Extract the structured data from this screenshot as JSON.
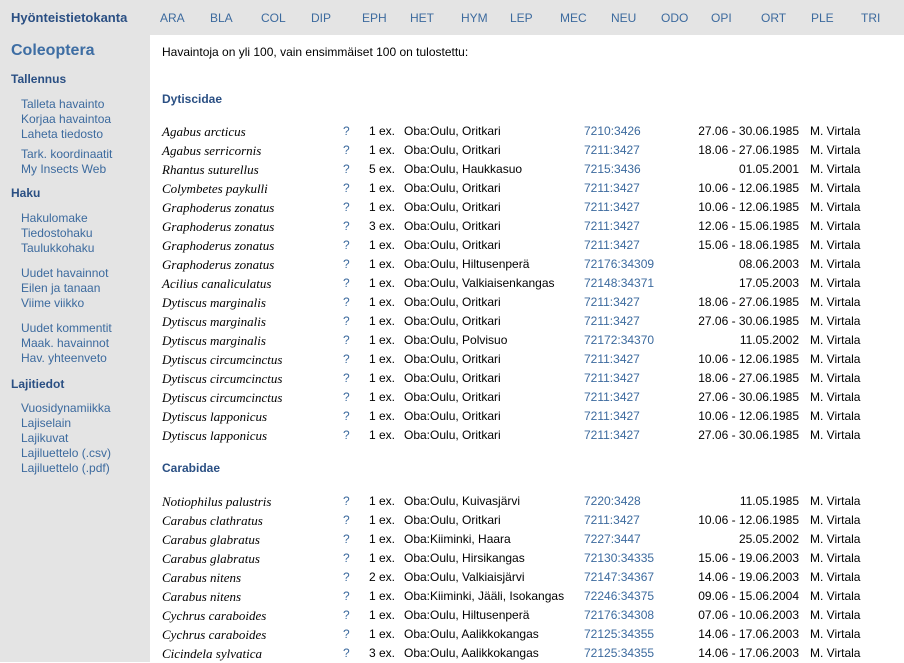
{
  "header": {
    "title": "Hyönteistietokanta",
    "nav": [
      "ARA",
      "BLA",
      "COL",
      "DIP",
      "EPH",
      "HET",
      "HYM",
      "LEP",
      "MEC",
      "NEU",
      "ODO",
      "OPI",
      "ORT",
      "PLE",
      "TRI"
    ]
  },
  "sidebar": {
    "title": "Coleoptera",
    "sections": [
      {
        "heading": "Tallennus",
        "links": [
          "Talleta havainto",
          "Korjaa havaintoa",
          "Laheta tiedosto",
          "Tark. koordinaatit",
          "My Insects Web"
        ]
      },
      {
        "heading": "Haku",
        "links": [
          "Hakulomake",
          "Tiedostohaku",
          "Taulukkohaku",
          "Uudet havainnot",
          "Eilen ja tanaan",
          "Viime viikko",
          "Uudet kommentit",
          "Maak. havainnot",
          "Hav. yhteenveto"
        ]
      },
      {
        "heading": "Lajitiedot",
        "links": [
          "Vuosidynamiikka",
          "Lajiselain",
          "Lajikuvat",
          "Lajiluettelo (.csv)",
          "Lajiluettelo (.pdf)"
        ]
      }
    ]
  },
  "main": {
    "intro": "Havaintoja on yli 100, vain ensimmäiset 100 on tulostettu:",
    "families": [
      {
        "name": "Dytiscidae",
        "rows": [
          {
            "species": "Agabus arcticus",
            "q": "?",
            "count": "1 ex.",
            "location": "Oba:Oulu, Oritkari",
            "grid": "7210:3426",
            "date": "27.06 - 30.06.1985",
            "observer": "M. Virtala"
          },
          {
            "species": "Agabus serricornis",
            "q": "?",
            "count": "1 ex.",
            "location": "Oba:Oulu, Oritkari",
            "grid": "7211:3427",
            "date": "18.06 - 27.06.1985",
            "observer": "M. Virtala"
          },
          {
            "species": "Rhantus suturellus",
            "q": "?",
            "count": "5 ex.",
            "location": "Oba:Oulu, Haukkasuo",
            "grid": "7215:3436",
            "date": "01.05.2001",
            "observer": "M. Virtala"
          },
          {
            "species": "Colymbetes paykulli",
            "q": "?",
            "count": "1 ex.",
            "location": "Oba:Oulu, Oritkari",
            "grid": "7211:3427",
            "date": "10.06 - 12.06.1985",
            "observer": "M. Virtala"
          },
          {
            "species": "Graphoderus zonatus",
            "q": "?",
            "count": "1 ex.",
            "location": "Oba:Oulu, Oritkari",
            "grid": "7211:3427",
            "date": "10.06 - 12.06.1985",
            "observer": "M. Virtala"
          },
          {
            "species": "Graphoderus zonatus",
            "q": "?",
            "count": "3 ex.",
            "location": "Oba:Oulu, Oritkari",
            "grid": "7211:3427",
            "date": "12.06 - 15.06.1985",
            "observer": "M. Virtala"
          },
          {
            "species": "Graphoderus zonatus",
            "q": "?",
            "count": "1 ex.",
            "location": "Oba:Oulu, Oritkari",
            "grid": "7211:3427",
            "date": "15.06 - 18.06.1985",
            "observer": "M. Virtala"
          },
          {
            "species": "Graphoderus zonatus",
            "q": "?",
            "count": "1 ex.",
            "location": "Oba:Oulu, Hiltusenperä",
            "grid": "72176:34309",
            "date": "08.06.2003",
            "observer": "M. Virtala"
          },
          {
            "species": "Acilius canaliculatus",
            "q": "?",
            "count": "1 ex.",
            "location": "Oba:Oulu, Valkiaisenkangas",
            "grid": "72148:34371",
            "date": "17.05.2003",
            "observer": "M. Virtala"
          },
          {
            "species": "Dytiscus marginalis",
            "q": "?",
            "count": "1 ex.",
            "location": "Oba:Oulu, Oritkari",
            "grid": "7211:3427",
            "date": "18.06 - 27.06.1985",
            "observer": "M. Virtala"
          },
          {
            "species": "Dytiscus marginalis",
            "q": "?",
            "count": "1 ex.",
            "location": "Oba:Oulu, Oritkari",
            "grid": "7211:3427",
            "date": "27.06 - 30.06.1985",
            "observer": "M. Virtala"
          },
          {
            "species": "Dytiscus marginalis",
            "q": "?",
            "count": "1 ex.",
            "location": "Oba:Oulu, Polvisuo",
            "grid": "72172:34370",
            "date": "11.05.2002",
            "observer": "M. Virtala"
          },
          {
            "species": "Dytiscus circumcinctus",
            "q": "?",
            "count": "1 ex.",
            "location": "Oba:Oulu, Oritkari",
            "grid": "7211:3427",
            "date": "10.06 - 12.06.1985",
            "observer": "M. Virtala"
          },
          {
            "species": "Dytiscus circumcinctus",
            "q": "?",
            "count": "1 ex.",
            "location": "Oba:Oulu, Oritkari",
            "grid": "7211:3427",
            "date": "18.06 - 27.06.1985",
            "observer": "M. Virtala"
          },
          {
            "species": "Dytiscus circumcinctus",
            "q": "?",
            "count": "1 ex.",
            "location": "Oba:Oulu, Oritkari",
            "grid": "7211:3427",
            "date": "27.06 - 30.06.1985",
            "observer": "M. Virtala"
          },
          {
            "species": "Dytiscus lapponicus",
            "q": "?",
            "count": "1 ex.",
            "location": "Oba:Oulu, Oritkari",
            "grid": "7211:3427",
            "date": "10.06 - 12.06.1985",
            "observer": "M. Virtala"
          },
          {
            "species": "Dytiscus lapponicus",
            "q": "?",
            "count": "1 ex.",
            "location": "Oba:Oulu, Oritkari",
            "grid": "7211:3427",
            "date": "27.06 - 30.06.1985",
            "observer": "M. Virtala"
          }
        ]
      },
      {
        "name": "Carabidae",
        "rows": [
          {
            "species": "Notiophilus palustris",
            "q": "?",
            "count": "1 ex.",
            "location": "Oba:Oulu, Kuivasjärvi",
            "grid": "7220:3428",
            "date": "11.05.1985",
            "observer": "M. Virtala"
          },
          {
            "species": "Carabus clathratus",
            "q": "?",
            "count": "1 ex.",
            "location": "Oba:Oulu, Oritkari",
            "grid": "7211:3427",
            "date": "10.06 - 12.06.1985",
            "observer": "M. Virtala"
          },
          {
            "species": "Carabus glabratus",
            "q": "?",
            "count": "1 ex.",
            "location": "Oba:Kiiminki, Haara",
            "grid": "7227:3447",
            "date": "25.05.2002",
            "observer": "M. Virtala"
          },
          {
            "species": "Carabus glabratus",
            "q": "?",
            "count": "1 ex.",
            "location": "Oba:Oulu, Hirsikangas",
            "grid": "72130:34335",
            "date": "15.06 - 19.06.2003",
            "observer": "M. Virtala"
          },
          {
            "species": "Carabus nitens",
            "q": "?",
            "count": "2 ex.",
            "location": "Oba:Oulu, Valkiaisjärvi",
            "grid": "72147:34367",
            "date": "14.06 - 19.06.2003",
            "observer": "M. Virtala"
          },
          {
            "species": "Carabus nitens",
            "q": "?",
            "count": "1 ex.",
            "location": "Oba:Kiiminki, Jääli, Isokangas",
            "grid": "72246:34375",
            "date": "09.06 - 15.06.2004",
            "observer": "M. Virtala"
          },
          {
            "species": "Cychrus caraboides",
            "q": "?",
            "count": "1 ex.",
            "location": "Oba:Oulu, Hiltusenperä",
            "grid": "72176:34308",
            "date": "07.06 - 10.06.2003",
            "observer": "M. Virtala"
          },
          {
            "species": "Cychrus caraboides",
            "q": "?",
            "count": "1 ex.",
            "location": "Oba:Oulu, Aalikkokangas",
            "grid": "72125:34355",
            "date": "14.06 - 17.06.2003",
            "observer": "M. Virtala"
          },
          {
            "species": "Cicindela sylvatica",
            "q": "?",
            "count": "3 ex.",
            "location": "Oba:Oulu, Aalikkokangas",
            "grid": "72125:34355",
            "date": "14.06 - 17.06.2003",
            "observer": "M. Virtala"
          }
        ]
      }
    ]
  }
}
